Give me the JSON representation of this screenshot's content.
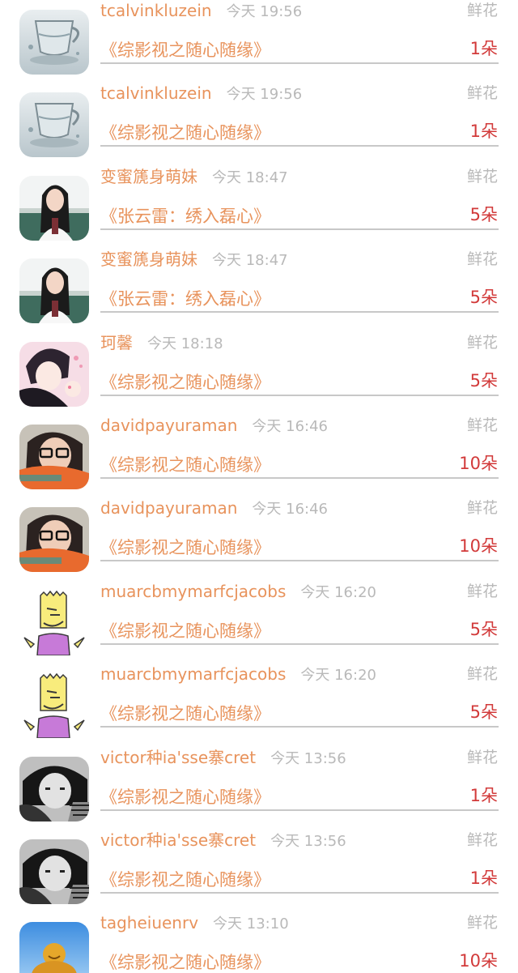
{
  "rows": [
    {
      "name": "tcalvinkluzein",
      "time": "今天 19:56",
      "gift": "鲜花",
      "work": "《综影视之随心随缘》",
      "count": "1朵",
      "avatar": "glass-cup"
    },
    {
      "name": "tcalvinkluzein",
      "time": "今天 19:56",
      "gift": "鲜花",
      "work": "《综影视之随心随缘》",
      "count": "1朵",
      "avatar": "glass-cup"
    },
    {
      "name": "变蜜篪身萌妹",
      "time": "今天 18:47",
      "gift": "鲜花",
      "work": "《张云雷：绣入磊心》",
      "count": "5朵",
      "avatar": "girl-classroom"
    },
    {
      "name": "变蜜篪身萌妹",
      "time": "今天 18:47",
      "gift": "鲜花",
      "work": "《张云雷：绣入磊心》",
      "count": "5朵",
      "avatar": "girl-classroom"
    },
    {
      "name": "珂馨",
      "time": "今天 18:18",
      "gift": "鲜花",
      "work": "《综影视之随心随缘》",
      "count": "5朵",
      "avatar": "anime-boy"
    },
    {
      "name": "davidpayuraman",
      "time": "今天 16:46",
      "gift": "鲜花",
      "work": "《综影视之随心随缘》",
      "count": "10朵",
      "avatar": "girl-glasses"
    },
    {
      "name": "davidpayuraman",
      "time": "今天 16:46",
      "gift": "鲜花",
      "work": "《综影视之随心随缘》",
      "count": "10朵",
      "avatar": "girl-glasses"
    },
    {
      "name": "muarcbmymarfcjacobs",
      "time": "今天 16:20",
      "gift": "鲜花",
      "work": "《综影视之随心随缘》",
      "count": "5朵",
      "avatar": "cartoon-bart"
    },
    {
      "name": "muarcbmymarfcjacobs",
      "time": "今天 16:20",
      "gift": "鲜花",
      "work": "《综影视之随心随缘》",
      "count": "5朵",
      "avatar": "cartoon-bart"
    },
    {
      "name": "victor种ia'sse寨cret",
      "time": "今天 13:56",
      "gift": "鲜花",
      "work": "《综影视之随心随缘》",
      "count": "1朵",
      "avatar": "bw-girl"
    },
    {
      "name": "victor种ia'sse寨cret",
      "time": "今天 13:56",
      "gift": "鲜花",
      "work": "《综影视之随心随缘》",
      "count": "1朵",
      "avatar": "bw-girl"
    },
    {
      "name": "tagheiuenrv",
      "time": "今天 13:10",
      "gift": "鲜花",
      "work": "《综影视之随心随缘》",
      "count": "10朵",
      "avatar": "golden-buddha"
    }
  ]
}
